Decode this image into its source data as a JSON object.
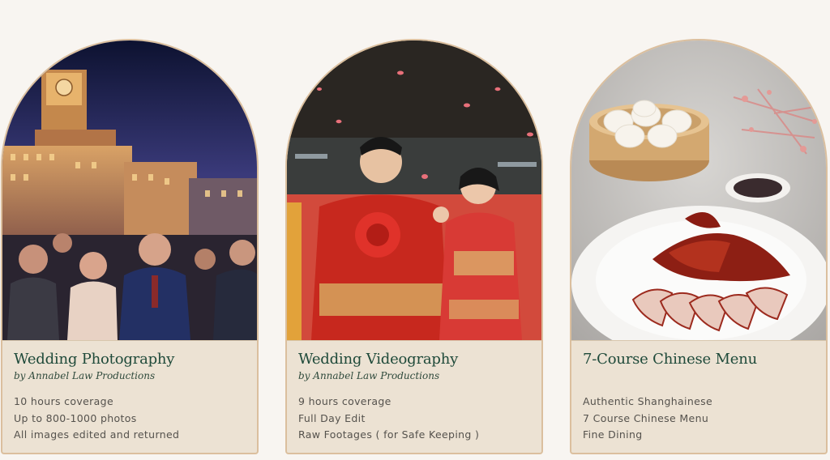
{
  "packages": [
    {
      "title": "Wedding Photography",
      "byline": "by Annabel Law Productions",
      "image_icon": "wedding-couple-night-city-photo",
      "features": [
        "10 hours coverage",
        "Up to 800-1000 photos",
        "All images edited and returned"
      ]
    },
    {
      "title": "Wedding Videography",
      "byline": "by Annabel Law Productions",
      "image_icon": "chinese-wedding-couple-photo",
      "features": [
        "9 hours coverage",
        "Full Day Edit",
        "Raw Footages ( for Safe Keeping )"
      ]
    },
    {
      "title": "7-Course Chinese Menu",
      "byline": "",
      "image_icon": "roast-duck-dumplings-photo",
      "features": [
        "Authentic Shanghainese",
        "7 Course Chinese Menu",
        "Fine Dining"
      ]
    }
  ],
  "colors": {
    "page_background": "#f8f5f1",
    "card_border": "#dbbf9e",
    "card_info_background": "#ece2d3",
    "title_green": "#1f4a3a",
    "body_text": "#55524d"
  }
}
